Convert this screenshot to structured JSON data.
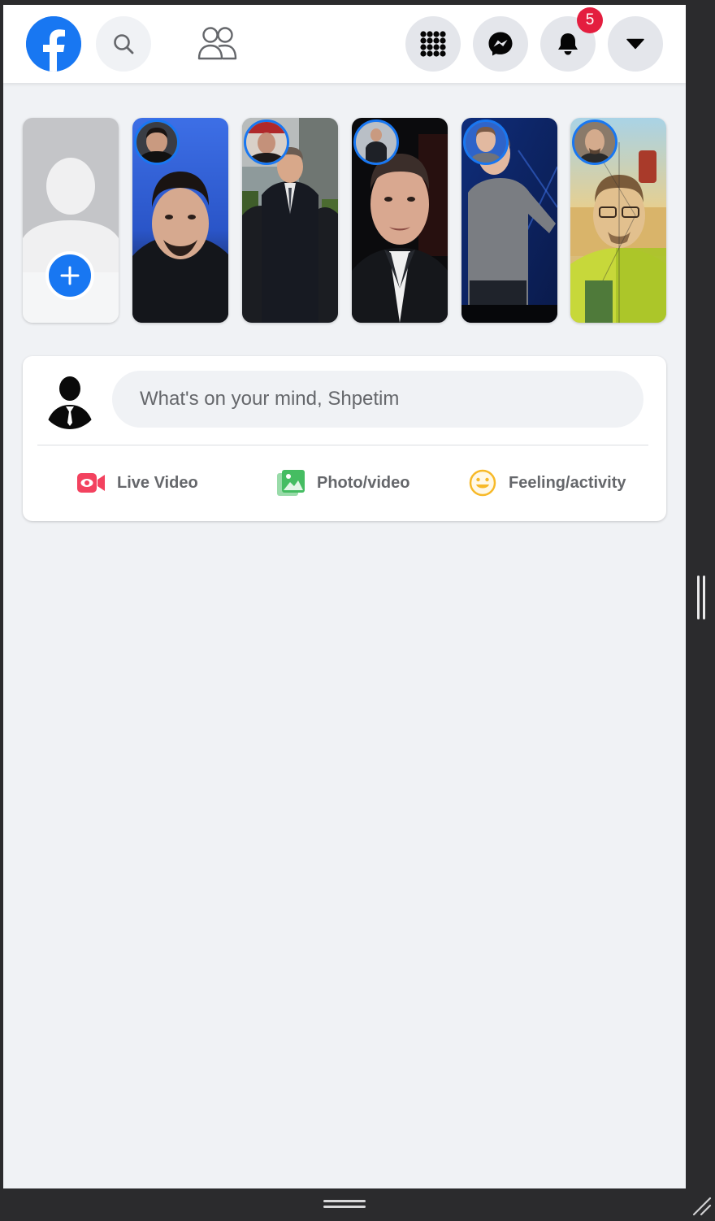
{
  "nav": {
    "logo_glyph": "f",
    "notifications_badge": "5",
    "icons": [
      "facebook-logo",
      "search-icon",
      "friends-icon",
      "menu-grid-icon",
      "messenger-icon",
      "bell-icon",
      "caret-down-icon"
    ],
    "brand_color": "#1877f2",
    "badge_color": "#e41e3f"
  },
  "stories": [
    {
      "type": "create"
    },
    {
      "type": "story"
    },
    {
      "type": "story"
    },
    {
      "type": "story"
    },
    {
      "type": "story"
    },
    {
      "type": "story"
    }
  ],
  "composer": {
    "placeholder": "What's on your mind, Shpetim",
    "actions": [
      {
        "label": "Live Video",
        "icon": "live-video-icon",
        "color": "#f3425f"
      },
      {
        "label": "Photo/video",
        "icon": "photo-icon",
        "color": "#45bd62"
      },
      {
        "label": "Feeling/activity",
        "icon": "smiley-icon",
        "color": "#f7b928"
      }
    ]
  }
}
